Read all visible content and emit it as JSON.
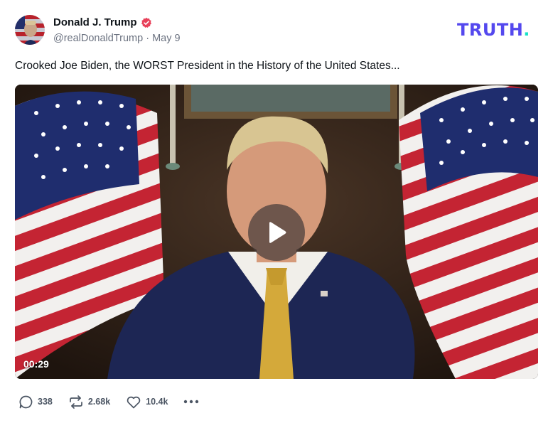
{
  "post": {
    "author": {
      "display_name": "Donald J. Trump",
      "verified": true,
      "handle": "@realDonaldTrump",
      "date": "May 9"
    },
    "text": "Crooked Joe Biden, the WORST President in the History of the United States...",
    "video": {
      "duration": "00:29"
    },
    "stats": {
      "replies": "338",
      "retruths": "2.68k",
      "likes": "10.4k"
    }
  },
  "brand": {
    "logo_text": "TRUTH",
    "logo_dot": ".",
    "logo_color": "#5448ee",
    "dot_color": "#17e2c7"
  },
  "colors": {
    "verified_badge": "#e8415a",
    "muted_text": "#6b7280"
  },
  "icons": {
    "reply": "reply-icon",
    "retruth": "retruth-icon",
    "like": "heart-icon",
    "more": "more-icon",
    "play": "play-icon",
    "verified": "verified-badge-icon"
  }
}
